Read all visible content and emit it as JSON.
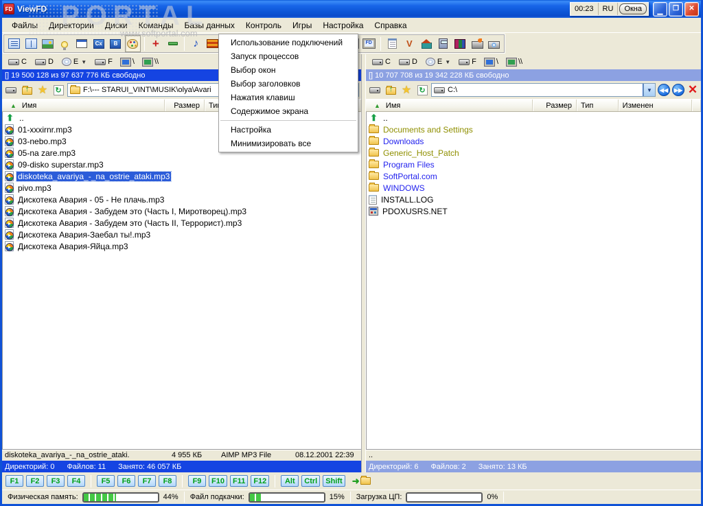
{
  "window": {
    "title": "ViewFD",
    "clock": "00:23",
    "lang": "RU",
    "windows_button": "Окна"
  },
  "watermark": {
    "title": "PORTAL",
    "subtitle": "www.softportal.com"
  },
  "menubar": {
    "items": [
      "Файлы",
      "Директории",
      "Диски",
      "Команды",
      "Базы данных",
      "Контроль",
      "Игры",
      "Настройка",
      "Справка"
    ]
  },
  "context_menu": {
    "items": [
      "Использование подключений",
      "Запуск процессов",
      "Выбор окон",
      "Выбор заголовков",
      "Нажатия клавиш",
      "Содержимое экрана",
      "Настройка",
      "Минимизировать все"
    ]
  },
  "toolbar": {
    "icons": [
      "details-view",
      "columns-view",
      "image-view",
      "quick-view",
      "window-view",
      "codepage",
      "bold-font",
      "palette",
      "add",
      "remove",
      "sound",
      "panel-view",
      "screen",
      "fd-screen",
      "notepad",
      "draw-tools",
      "home-tools",
      "calculator",
      "archive-books",
      "cd-burner",
      "cd-drive"
    ],
    "pressed_icon": "palette"
  },
  "left_pane": {
    "drives": [
      "C",
      "D",
      "E",
      "F",
      "\\",
      "\\\\"
    ],
    "free_space": "[] 19 500 128 из 97 637 776 КБ свободно",
    "path": "F:\\---   STARUI_VINT\\MUSIK\\olya\\Avari",
    "columns": [
      "Имя",
      "Размер",
      "Тип"
    ],
    "files": [
      "..",
      "01-xxxirnr.mp3",
      "03-nebo.mp3",
      "05-na zare.mp3",
      "09-disko superstar.mp3",
      "diskoteka_avariya_-_na_ostrie_ataki.mp3",
      "pivo.mp3",
      "Дискотека Авария - 05 - Не плачь.mp3",
      "Дискотека Авария - Забудем это (Часть I, Миротворец).mp3",
      "Дискотека Авария - Забудем это (Часть II, Террорист).mp3",
      "Дискотека Авария-Заебал ты!.mp3",
      "Дискотека Авария-Яйца.mp3"
    ],
    "selected_file": "diskoteka_avariya_-_na_ostrie_ataki.mp3",
    "status_file": {
      "name": "diskoteka_avariya_-_na_ostrie_ataki.",
      "size": "4 955 КБ",
      "type": "AIMP MP3 File",
      "date": "08.12.2001 22:39"
    },
    "summary": {
      "dirs": "Директорий: 0",
      "files": "Файлов: 11",
      "used": "Занято: 46 057 КБ"
    }
  },
  "right_pane": {
    "drives": [
      "C",
      "D",
      "E",
      "F",
      "\\",
      "\\\\"
    ],
    "free_space": "[] 10 707 708 из 19 342 228 КБ свободно",
    "path": "C:\\",
    "columns": [
      "Имя",
      "Размер",
      "Тип",
      "Изменен"
    ],
    "files": [
      "..",
      "Documents and Settings",
      "Downloads",
      "Generic_Host_Patch",
      "Program Files",
      "SoftPortal.com",
      "WINDOWS",
      "INSTALL.LOG",
      "PDOXUSRS.NET"
    ],
    "status_file": "..",
    "summary": {
      "dirs": "Директорий: 6",
      "files": "Файлов: 2",
      "used": "Занято: 13 КБ"
    }
  },
  "fkeys": [
    "F1",
    "F2",
    "F3",
    "F4",
    "F5",
    "F6",
    "F7",
    "F8",
    "F9",
    "F10",
    "F11",
    "F12",
    "Alt",
    "Ctrl",
    "Shift"
  ],
  "statusbar": {
    "mem_label": "Физическая память:",
    "mem_value": "44%",
    "mem_percent": 44,
    "swap_label": "Файл подкачки:",
    "swap_value": "15%",
    "swap_percent": 15,
    "cpu_label": "Загрузка ЦП:",
    "cpu_value": "0%",
    "cpu_percent": 0
  },
  "palette": {
    "titlebar_blue": "#0B54D4",
    "active_bar": "#1544E2",
    "inactive_bar": "#8CA1E2",
    "selection": "#2B5CD9",
    "chrome": "#ECE9D8",
    "fkey_text_green": "#00A018",
    "progress_green": "#44C844",
    "folder_text_olive": "#8F8F00",
    "folder_text_blue": "#2222EE",
    "close_red": "#DD4A30",
    "border_blue": "#1052D6"
  }
}
